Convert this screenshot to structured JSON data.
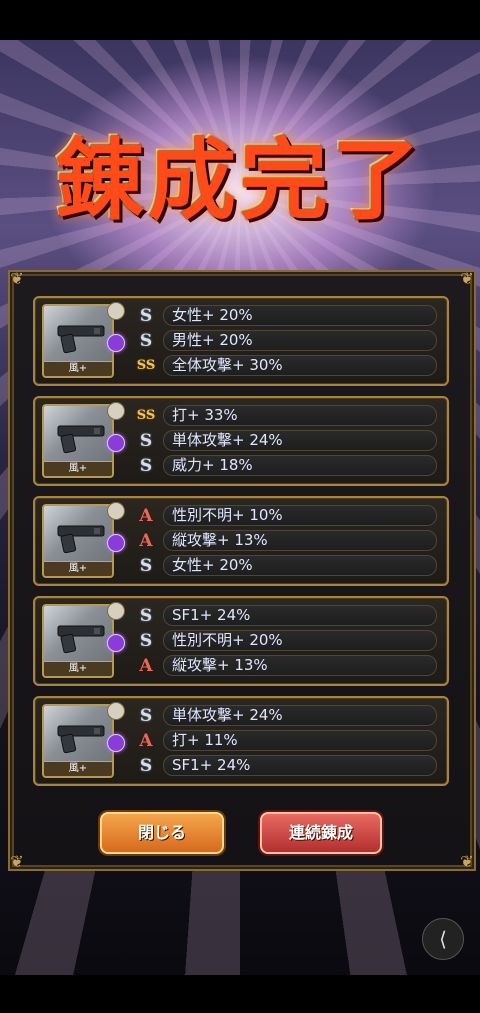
{
  "title": "錬成完了",
  "results": [
    {
      "weapon_label": "風+",
      "stats": [
        {
          "rank": "S",
          "text": "女性+ 20%"
        },
        {
          "rank": "S",
          "text": "男性+ 20%"
        },
        {
          "rank": "SS",
          "text": "全体攻撃+ 30%"
        }
      ]
    },
    {
      "weapon_label": "風+",
      "stats": [
        {
          "rank": "SS",
          "text": "打+ 33%"
        },
        {
          "rank": "S",
          "text": "単体攻撃+ 24%"
        },
        {
          "rank": "S",
          "text": "威力+ 18%"
        }
      ]
    },
    {
      "weapon_label": "風+",
      "stats": [
        {
          "rank": "A",
          "text": "性別不明+ 10%"
        },
        {
          "rank": "A",
          "text": "縦攻撃+ 13%"
        },
        {
          "rank": "S",
          "text": "女性+ 20%"
        }
      ]
    },
    {
      "weapon_label": "風+",
      "stats": [
        {
          "rank": "S",
          "text": "SF1+ 24%"
        },
        {
          "rank": "S",
          "text": "性別不明+ 20%"
        },
        {
          "rank": "A",
          "text": "縦攻撃+ 13%"
        }
      ]
    },
    {
      "weapon_label": "風+",
      "stats": [
        {
          "rank": "S",
          "text": "単体攻撃+ 24%"
        },
        {
          "rank": "A",
          "text": "打+ 11%"
        },
        {
          "rank": "S",
          "text": "SF1+ 24%"
        }
      ]
    }
  ],
  "buttons": {
    "close": "閉じる",
    "continue": "連続錬成"
  },
  "icons": {
    "share": "share-icon",
    "gun": "pistol-icon"
  },
  "colors": {
    "frame": "#a8843f",
    "title": "#ff4a1a",
    "close_button": "#e8862f",
    "continue_button": "#c83f3a"
  }
}
